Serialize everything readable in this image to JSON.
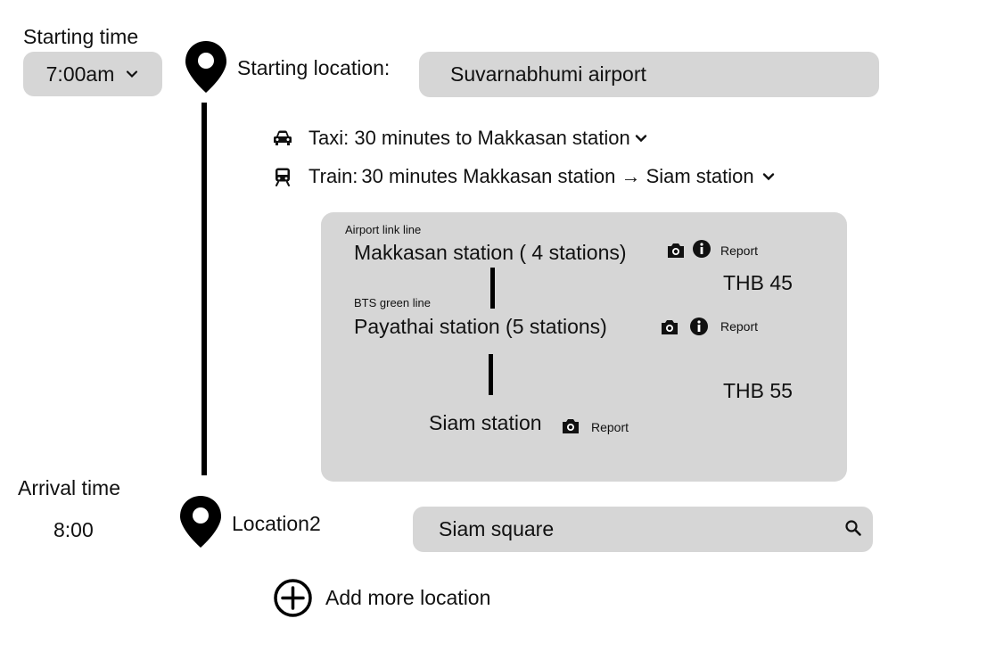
{
  "start": {
    "time_label": "Starting time",
    "time_value": "7:00am",
    "location_label": "Starting location:",
    "location_value": "Suvarnabhumi airport"
  },
  "steps": [
    {
      "icon": "car-icon",
      "text": "Taxi: 30 minutes to Makkasan station"
    },
    {
      "icon": "train-icon",
      "mode": "Train:",
      "text": "30 minutes Makkasan station → Siam station"
    }
  ],
  "details": {
    "segments": [
      {
        "line": "Airport link line",
        "station": "Makkasan station ( 4 stations)",
        "report": "Report",
        "price": "THB 45"
      },
      {
        "line": "BTS green line",
        "station": "Payathai station  (5 stations)",
        "report": "Report",
        "price": "THB 55"
      }
    ],
    "final": {
      "station": "Siam station",
      "report": "Report"
    }
  },
  "arrival": {
    "time_label": "Arrival time",
    "time_value": "8:00",
    "location_label": "Location2",
    "location_value": "Siam square"
  },
  "add_more": "Add more location",
  "colors": {
    "field_bg": "#d6d6d6",
    "ink": "#000000"
  }
}
